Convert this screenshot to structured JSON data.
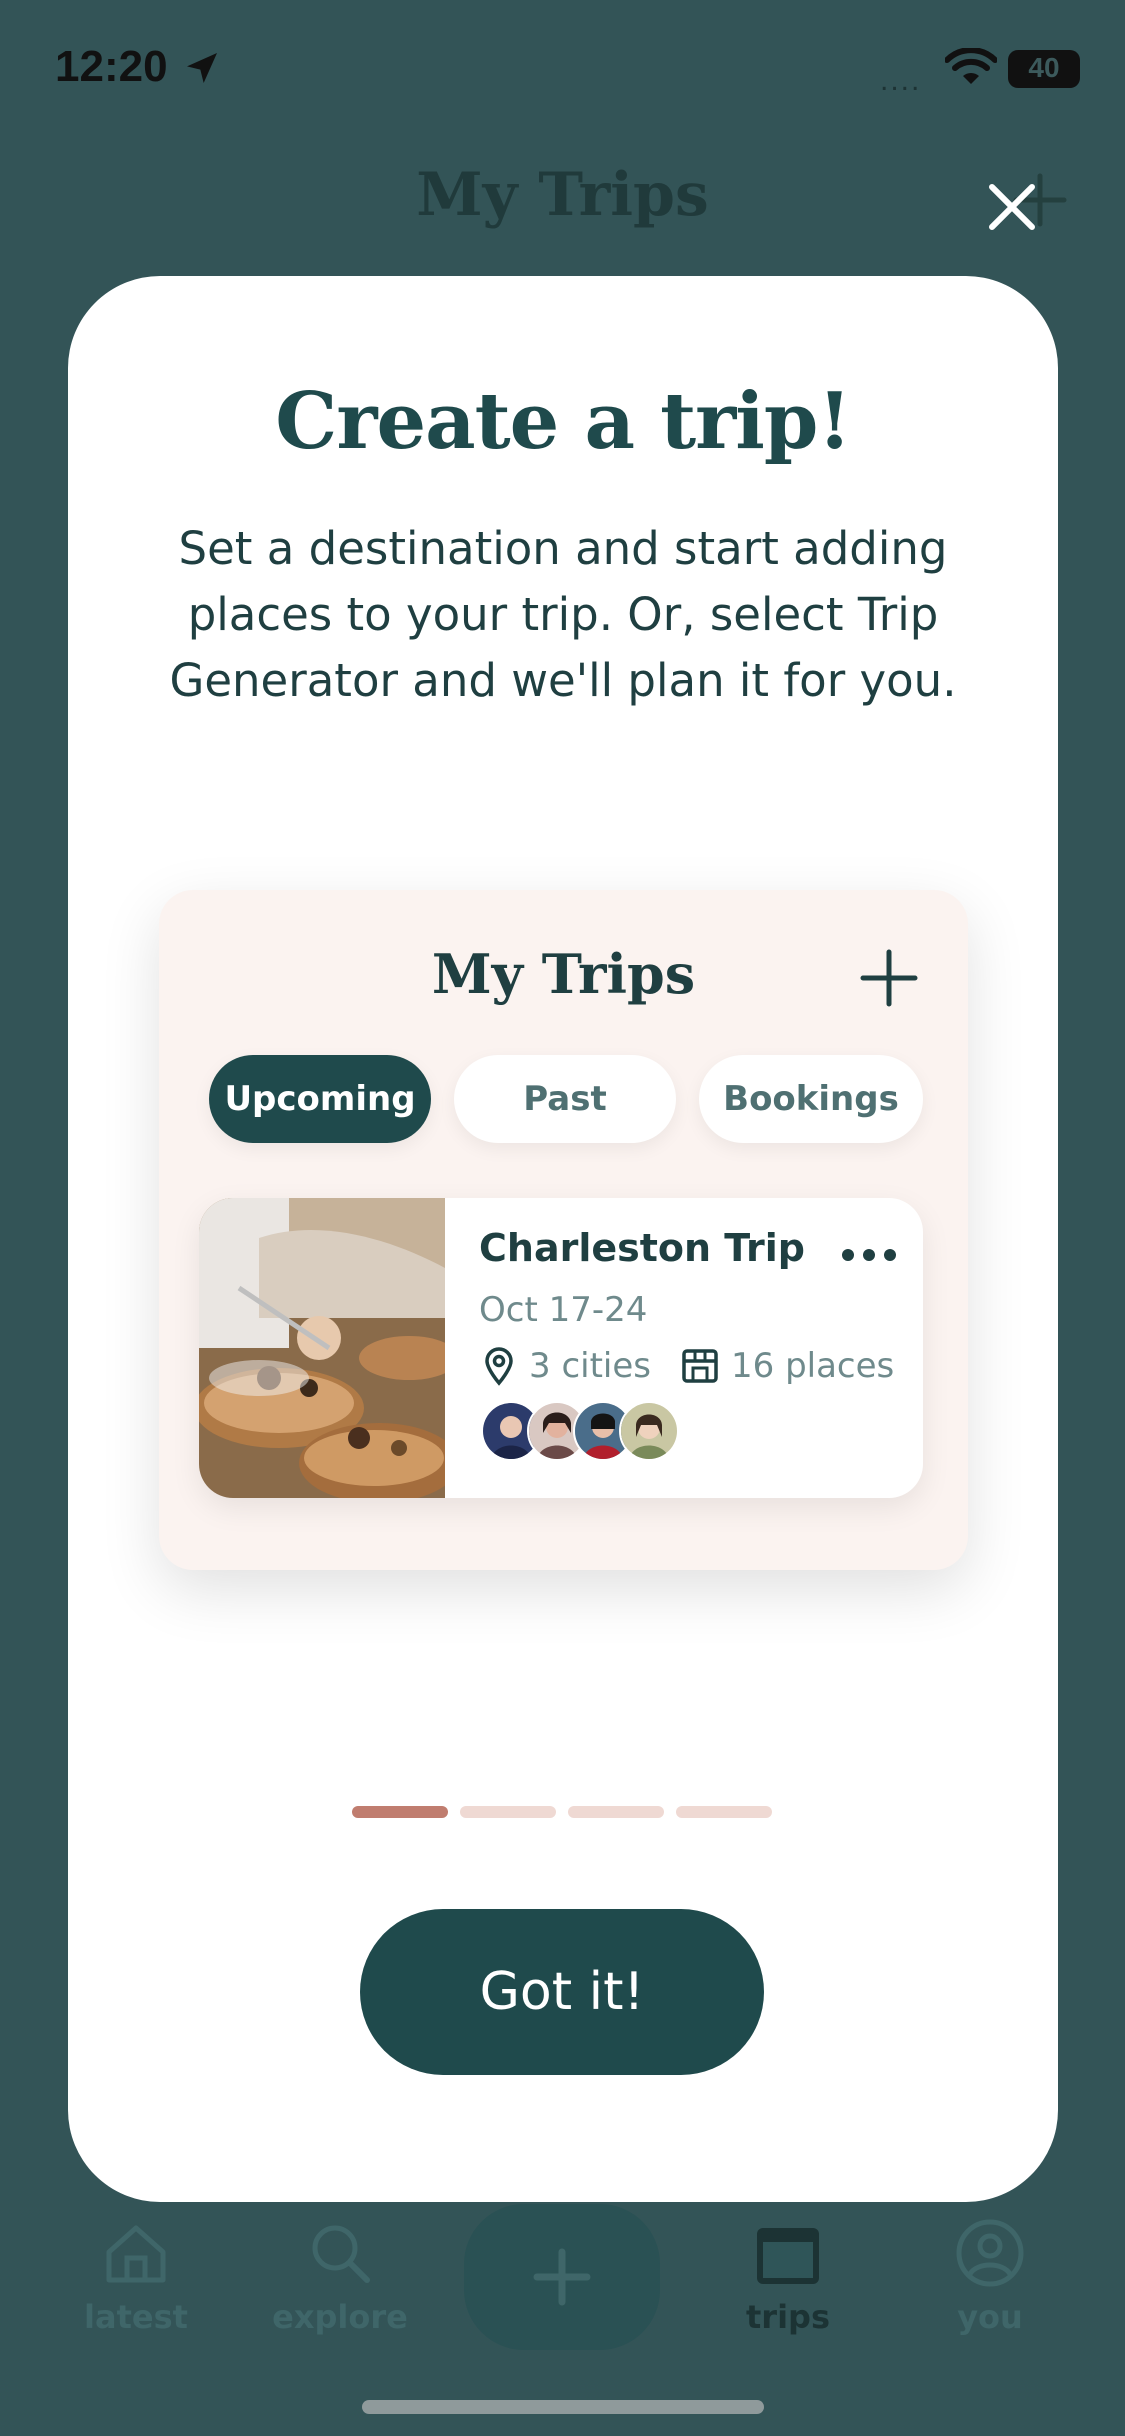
{
  "status_bar": {
    "time": "12:20",
    "battery": "40",
    "cellular": "...."
  },
  "background": {
    "title": "My Trips",
    "tabs": [
      {
        "label": "latest",
        "icon": "home-icon"
      },
      {
        "label": "explore",
        "icon": "search-icon"
      },
      {
        "label": "",
        "icon": "plus-icon"
      },
      {
        "label": "trips",
        "icon": "calendar-icon",
        "selected": true
      },
      {
        "label": "you",
        "icon": "person-icon"
      }
    ]
  },
  "modal": {
    "title": "Create a trip!",
    "description": "Set a destination and start adding places to your trip. Or, select Trip Generator and we'll plan it for you.",
    "preview": {
      "title": "My Trips",
      "tabs": [
        "Upcoming",
        "Past",
        "Bookings"
      ],
      "selected_tab": "Upcoming",
      "trip": {
        "name": "Charleston Trip",
        "dates": "Oct 17-24",
        "cities": "3 cities",
        "places": "16 places",
        "avatar_count": 4
      }
    },
    "page_indicator": {
      "pages": 4,
      "current": 1
    },
    "confirm_label": "Got it!"
  },
  "colors": {
    "background": "#335457",
    "primary": "#1f4a4c",
    "accent_dot": "#c07d6f",
    "preview_bg": "#fbf3f0"
  }
}
